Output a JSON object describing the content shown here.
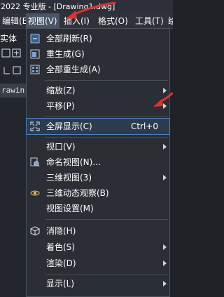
{
  "titlebar": {
    "text": "2022 专业版 - [Drawing1.dwg]"
  },
  "menubar": {
    "items": [
      {
        "label": "编辑(E)"
      },
      {
        "label": "视图(V)"
      },
      {
        "label": "插入(I)"
      },
      {
        "label": "格式(O)"
      },
      {
        "label": "工具(T)"
      },
      {
        "label": "绘"
      }
    ]
  },
  "leftpane": {
    "label": "实体",
    "tab_text": "rawin"
  },
  "dropdown": {
    "items": [
      {
        "label": "全部刷新(R)",
        "icon": "refresh-all-icon"
      },
      {
        "label": "重生成(G)",
        "icon": "regen-icon"
      },
      {
        "label": "全部重生成(A)",
        "icon": "regen-all-icon"
      },
      {
        "label": "缩放(Z)",
        "icon": "",
        "submenu": true
      },
      {
        "label": "平移(P)",
        "icon": "",
        "submenu": true
      },
      {
        "label": "全屏显示(C)",
        "icon": "fullscreen-icon",
        "shortcut": "Ctrl+0"
      },
      {
        "label": "视口(V)",
        "icon": "",
        "submenu": true
      },
      {
        "label": "命名视图(N)...",
        "icon": "named-view-icon"
      },
      {
        "label": "三维视图(3)",
        "icon": "",
        "submenu": true
      },
      {
        "label": "三维动态观察(B)",
        "icon": "orbit-icon"
      },
      {
        "label": "视图设置(M)",
        "icon": ""
      },
      {
        "label": "消隐(H)",
        "icon": "hide-icon"
      },
      {
        "label": "着色(S)",
        "icon": "",
        "submenu": true
      },
      {
        "label": "渲染(D)",
        "icon": "",
        "submenu": true
      },
      {
        "label": "显示(L)",
        "icon": "",
        "submenu": true
      }
    ]
  },
  "colors": {
    "highlight": "#4e7fc0",
    "annotation": "#e03030"
  }
}
